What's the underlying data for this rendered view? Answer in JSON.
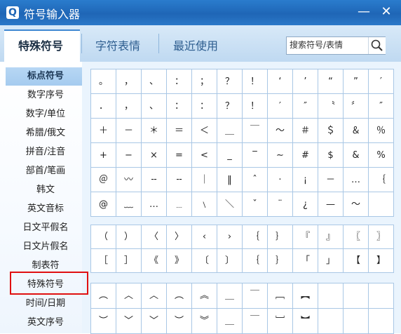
{
  "window": {
    "title": "符号输入器",
    "app_icon": "Q",
    "minimize": "—",
    "close": "✕"
  },
  "tabs": [
    {
      "label": "特殊符号",
      "active": true
    },
    {
      "label": "字符表情"
    },
    {
      "label": "最近使用"
    }
  ],
  "search": {
    "placeholder": "搜索符号/表情",
    "icon": "search-icon"
  },
  "sidebar": {
    "items": [
      "标点符号",
      "数字序号",
      "数字/单位",
      "希腊/俄文",
      "拼音/注音",
      "部首/笔画",
      "韩文",
      "英文音标",
      "日文平假名",
      "日文片假名",
      "制表符",
      "特殊符号",
      "时间/日期",
      "英文序号"
    ],
    "active_index": 0,
    "highlighted_index": 11
  },
  "grids": [
    [
      [
        "。",
        "，",
        "、",
        "：",
        "；",
        "？",
        "！",
        "‘",
        "’",
        "“",
        "”",
        "′"
      ],
      [
        "．",
        "，",
        "、",
        "：",
        "：",
        "？",
        "！",
        "′",
        "″",
        "〝",
        "〞",
        "″"
      ],
      [
        "＋",
        "－",
        "＊",
        "＝",
        "＜",
        "＿",
        "￣",
        "～",
        "＃",
        "＄",
        "＆",
        "％"
      ],
      [
        "+",
        "−",
        "×",
        "=",
        "<",
        "_",
        "‾",
        "∼",
        "#",
        "$",
        "&",
        "%"
      ],
      [
        "＠",
        "〰",
        "╌",
        "╌",
        "｜",
        "‖",
        "ˆ",
        "·",
        "¡",
        "－",
        "…",
        "｛"
      ],
      [
        "@",
        "﹏",
        "…",
        "﹍",
        "﹨",
        "＼",
        "ˇ",
        "¨",
        "¿",
        "—",
        "〜",
        ""
      ]
    ],
    [
      [
        "（",
        "）",
        "〈",
        "〉",
        "‹",
        "›",
        "｛",
        "｝",
        "『",
        "』",
        "〖",
        "〗"
      ],
      [
        "［",
        "］",
        "《",
        "》",
        "〔",
        "〕",
        "｛",
        "｝",
        "「",
        "」",
        "【",
        "】"
      ]
    ],
    [
      [
        "︵",
        "︿",
        "︿",
        "︵",
        "︽",
        "＿",
        "￣",
        "﹇",
        "︻",
        "",
        "",
        ""
      ],
      [
        "︶",
        "﹀",
        "﹀",
        "︶",
        "︾",
        "＿",
        "￣",
        "﹈",
        "︼",
        "",
        "",
        ""
      ]
    ]
  ]
}
